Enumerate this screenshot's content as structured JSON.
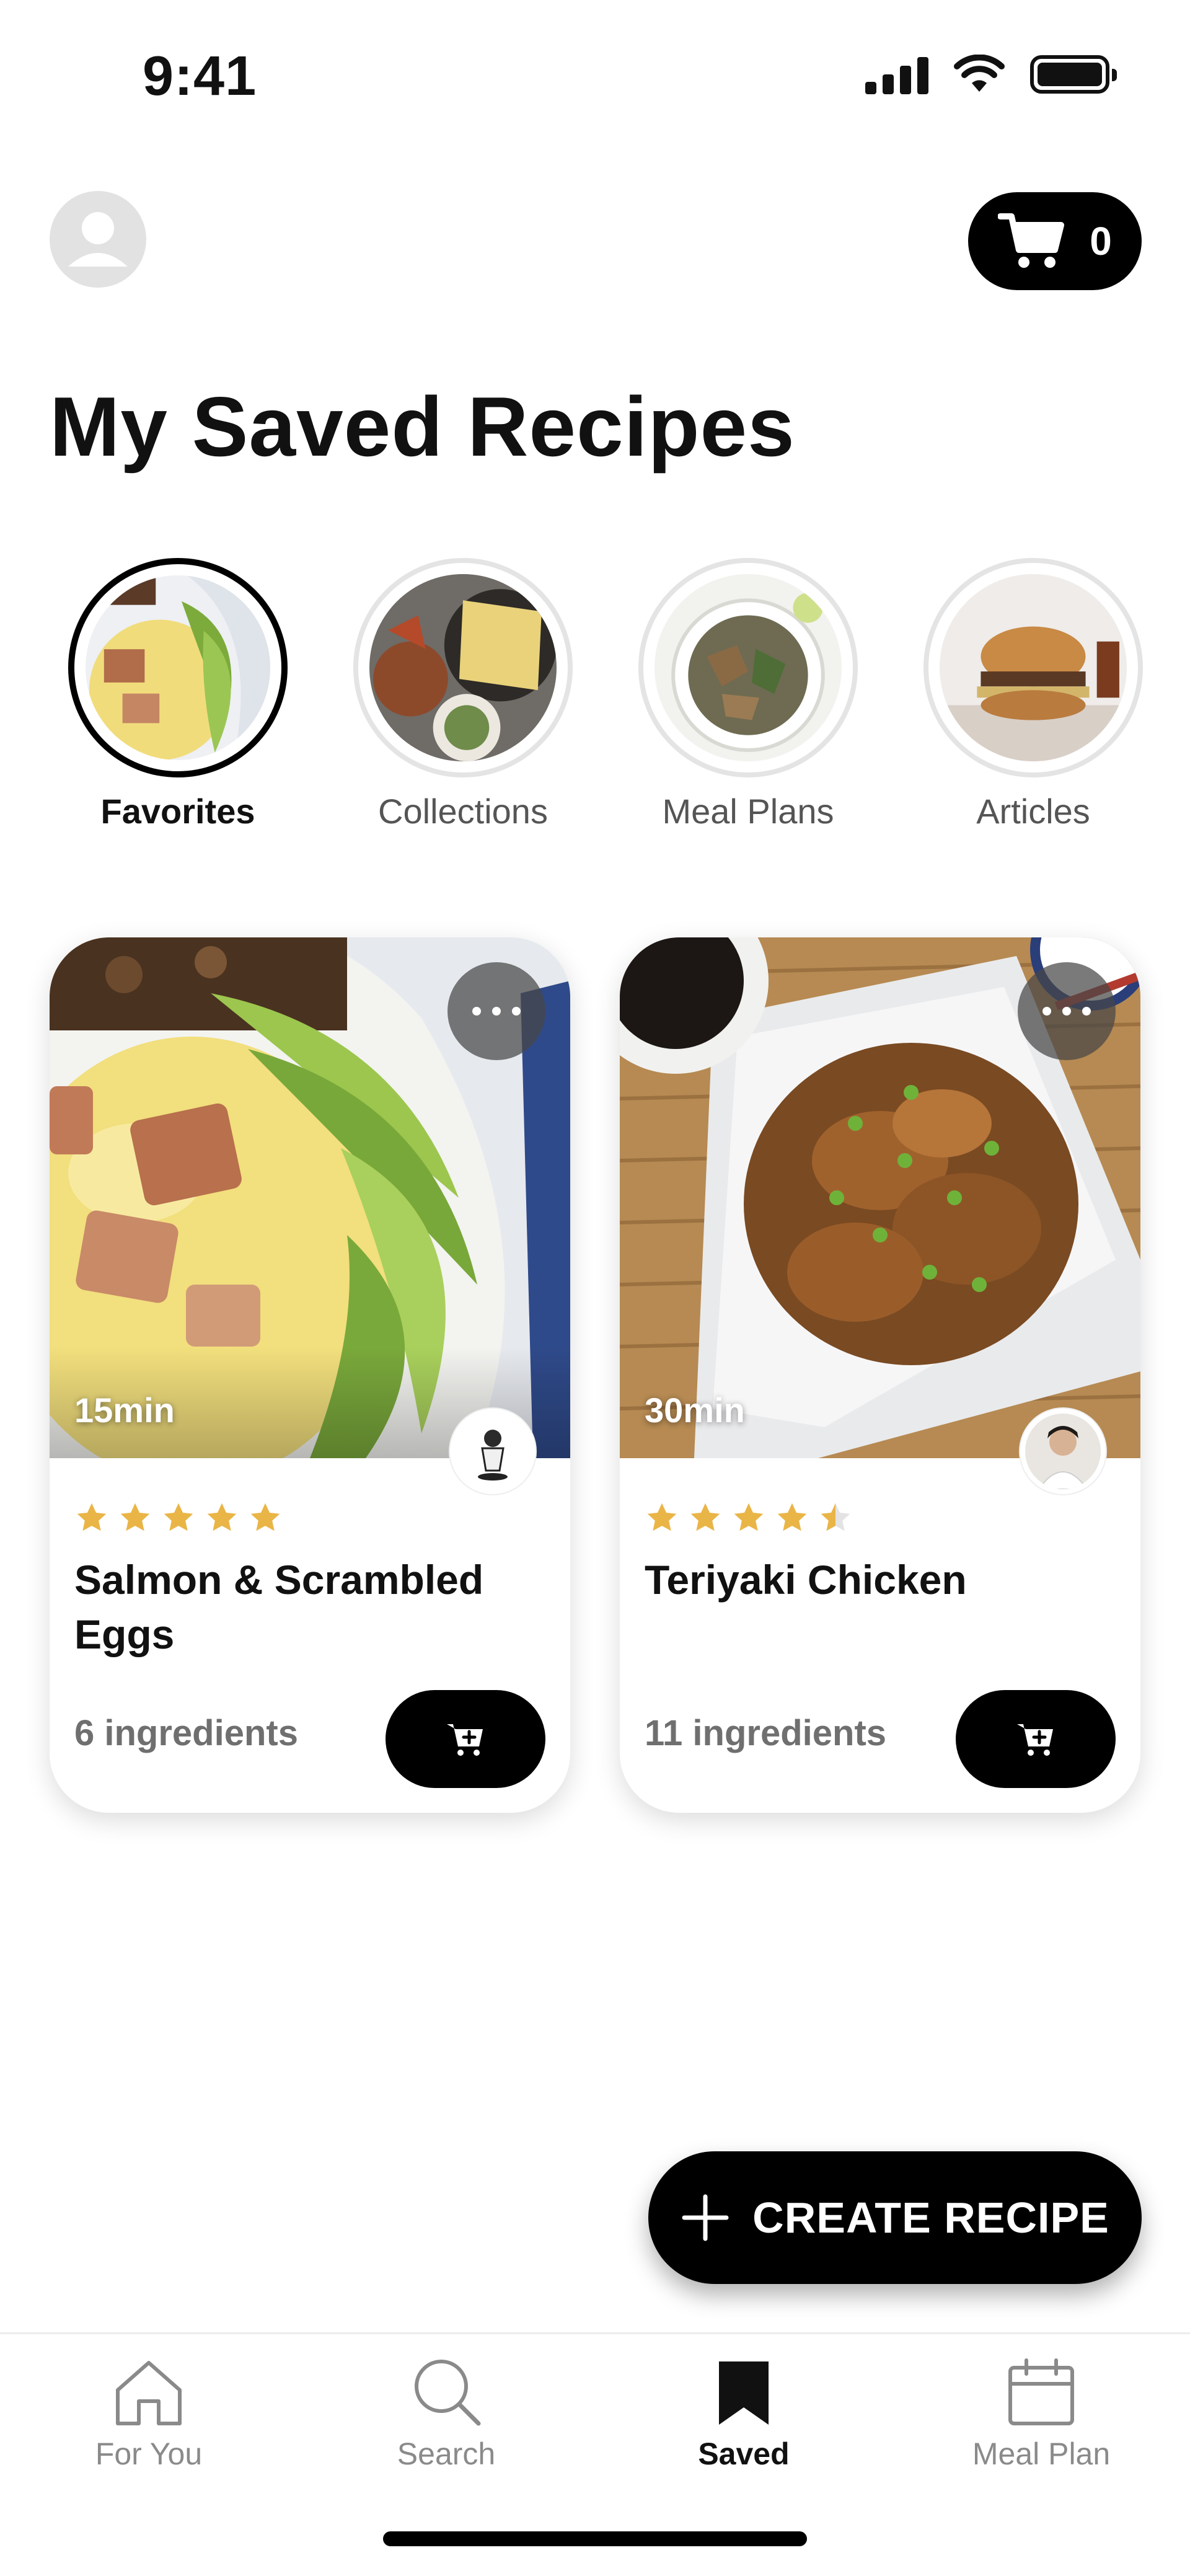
{
  "status_bar": {
    "time": "9:41"
  },
  "header": {
    "cart_count": "0"
  },
  "page_title": "My Saved Recipes",
  "categories": [
    {
      "label": "Favorites",
      "active": true
    },
    {
      "label": "Collections",
      "active": false
    },
    {
      "label": "Meal Plans",
      "active": false
    },
    {
      "label": "Articles",
      "active": false
    }
  ],
  "recipes": [
    {
      "time": "15min",
      "name": "Salmon & Scrambled Eggs",
      "rating": 5,
      "ingredients": "6 ingredients"
    },
    {
      "time": "30min",
      "name": "Teriyaki Chicken",
      "rating": 4.5,
      "ingredients": "11 ingredients"
    }
  ],
  "fab": {
    "label": "CREATE RECIPE"
  },
  "tabs": [
    {
      "label": "For You",
      "icon": "home-icon",
      "active": false
    },
    {
      "label": "Search",
      "icon": "search-icon",
      "active": false
    },
    {
      "label": "Saved",
      "icon": "bookmark-icon",
      "active": true
    },
    {
      "label": "Meal Plan",
      "icon": "calendar-icon",
      "active": false
    }
  ],
  "colors": {
    "accent": "#000000",
    "star": "#EAB547",
    "muted_text": "#6F6F6F",
    "inactive_ring": "#E4E4E4"
  }
}
